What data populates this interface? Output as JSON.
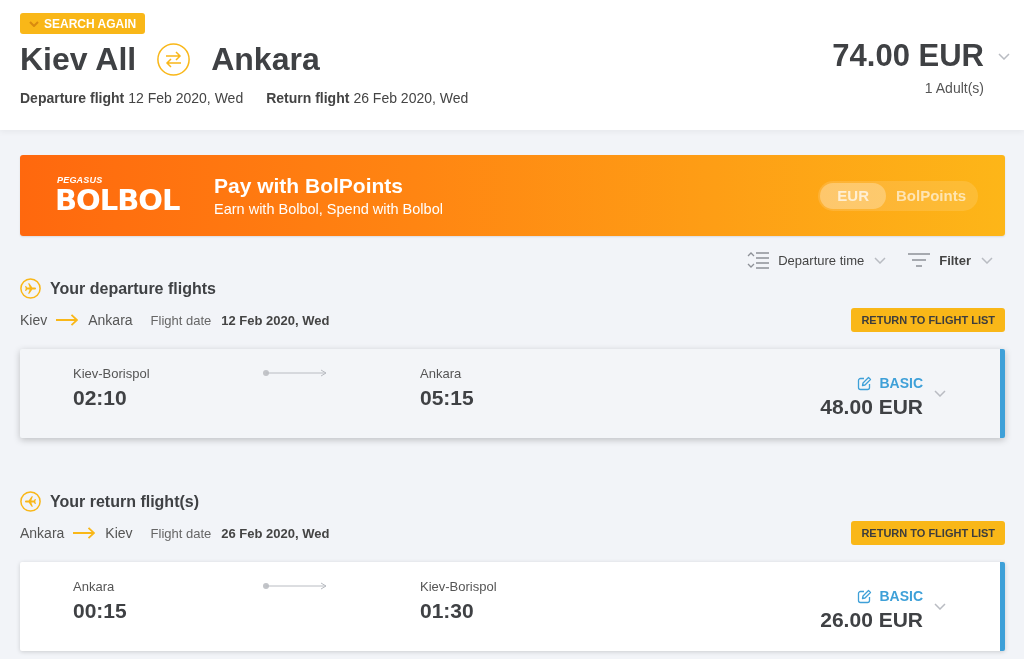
{
  "header": {
    "search_again_button": "SEARCH AGAIN",
    "origin": "Kiev All",
    "destination": "Ankara",
    "departure": {
      "label": "Departure flight",
      "date": "12 Feb 2020, Wed"
    },
    "return": {
      "label": "Return flight",
      "date": "26 Feb 2020, Wed"
    },
    "total_price": "74.00 EUR",
    "passengers": "1 Adult(s)"
  },
  "banner": {
    "logo": {
      "brand": "PEGASUS",
      "name": "BOLBOL"
    },
    "title": "Pay with BolPoints",
    "subtitle": "Earn with Bolbol, Spend with Bolbol",
    "currency_toggle": [
      {
        "label": "EUR",
        "selected": true
      },
      {
        "label": "BolPoints",
        "selected": false
      }
    ]
  },
  "toolbar": {
    "sort": "Departure time",
    "filter": "Filter"
  },
  "sections": [
    {
      "kind": "departure",
      "title": "Your departure flights",
      "from": "Kiev",
      "to": "Ankara",
      "date_label": "Flight date",
      "date": "12 Feb 2020, Wed",
      "return_button": "RETURN TO FLIGHT LIST",
      "flights": [
        {
          "origin": "Kiev-Borispol",
          "departure_time": "02:10",
          "destination": "Ankara",
          "arrival_time": "05:15",
          "fare": "BASIC",
          "price": "48.00 EUR",
          "selected": true,
          "hovered": true
        }
      ]
    },
    {
      "kind": "return",
      "title": "Your return flight(s)",
      "from": "Ankara",
      "to": "Kiev",
      "date_label": "Flight date",
      "date": "26 Feb 2020, Wed",
      "return_button": "RETURN TO FLIGHT LIST",
      "flights": [
        {
          "origin": "Ankara",
          "departure_time": "00:15",
          "destination": "Kiev-Borispol",
          "arrival_time": "01:30",
          "fare": "BASIC",
          "price": "26.00 EUR",
          "selected": true,
          "hovered": false
        }
      ]
    }
  ]
}
